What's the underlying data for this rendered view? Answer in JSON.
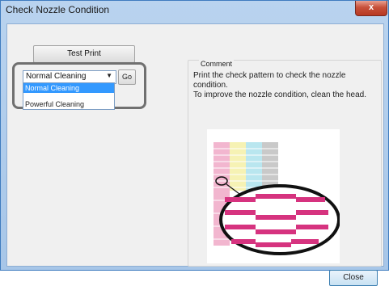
{
  "window": {
    "title": "Check Nozzle Condition",
    "close_glyph": "x"
  },
  "buttons": {
    "test_print": "Test Print",
    "go": "Go",
    "close": "Close"
  },
  "cleaning": {
    "selected": "Normal Cleaning",
    "options": [
      "Normal Cleaning",
      "Powerful Cleaning"
    ]
  },
  "comment": {
    "label": "Comment",
    "line1": "Print the check pattern to check the nozzle condition.",
    "line2": "To improve the nozzle condition, clean the head."
  },
  "colors": {
    "title_bar": "#a7c6e8",
    "magenta": "#d6337f",
    "cyan": "#39bfd6",
    "yellow": "#ece86b",
    "black": "#222222",
    "accent": "#3399ff"
  }
}
